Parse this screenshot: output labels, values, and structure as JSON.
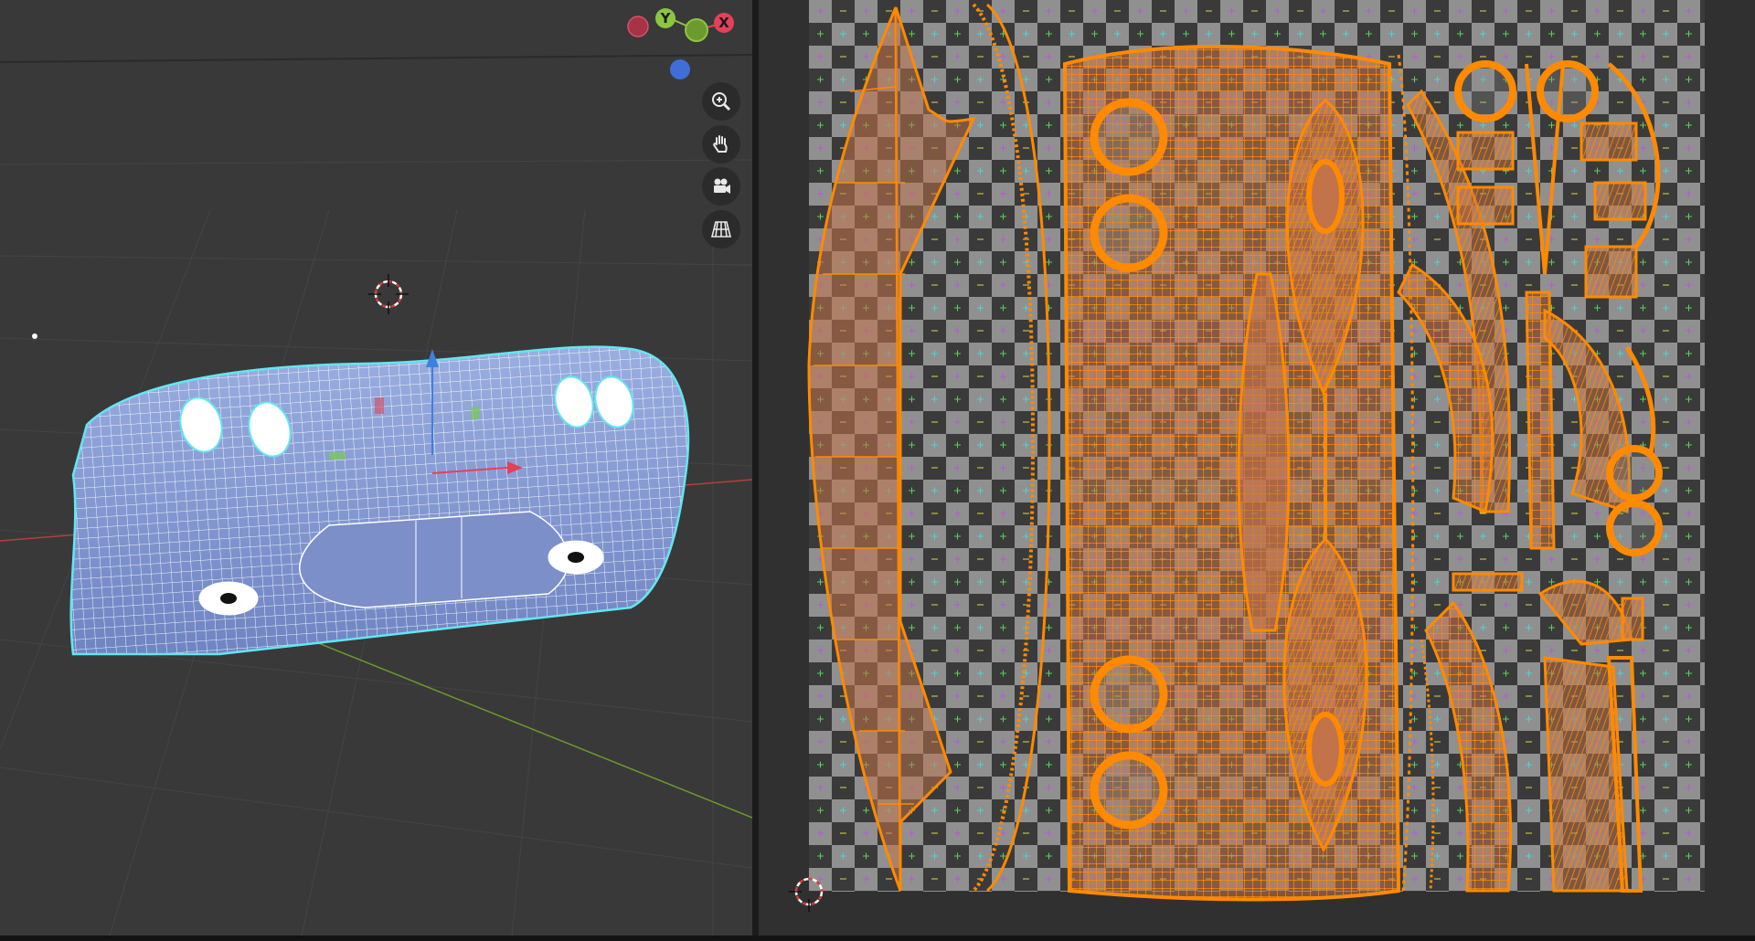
{
  "viewport": {
    "gizmo": {
      "axes": [
        {
          "label": "Y",
          "color": "#8cc63f"
        },
        {
          "label": "X",
          "color": "#e2415a"
        }
      ],
      "neg_x_color": "#a83246",
      "neg_y_color": "#6d9a2f",
      "z_color": "#3f6ed8"
    },
    "nav_buttons": [
      {
        "name": "zoom-icon"
      },
      {
        "name": "pan-hand-icon"
      },
      {
        "name": "camera-icon"
      },
      {
        "name": "perspective-grid-icon"
      }
    ],
    "mesh_wire_color": "#ffffff",
    "mesh_face_color": "#8ea3d6",
    "select_outline_color": "#63e6f0",
    "floor_x_axis_color": "#b2403f",
    "floor_y_axis_color": "#6a9a2b"
  },
  "uv_editor": {
    "checker_dark": "#3a3a3a",
    "checker_light": "#909090",
    "uv_edge_color": "#ff8a00",
    "uv_face_color": "#c27349"
  }
}
